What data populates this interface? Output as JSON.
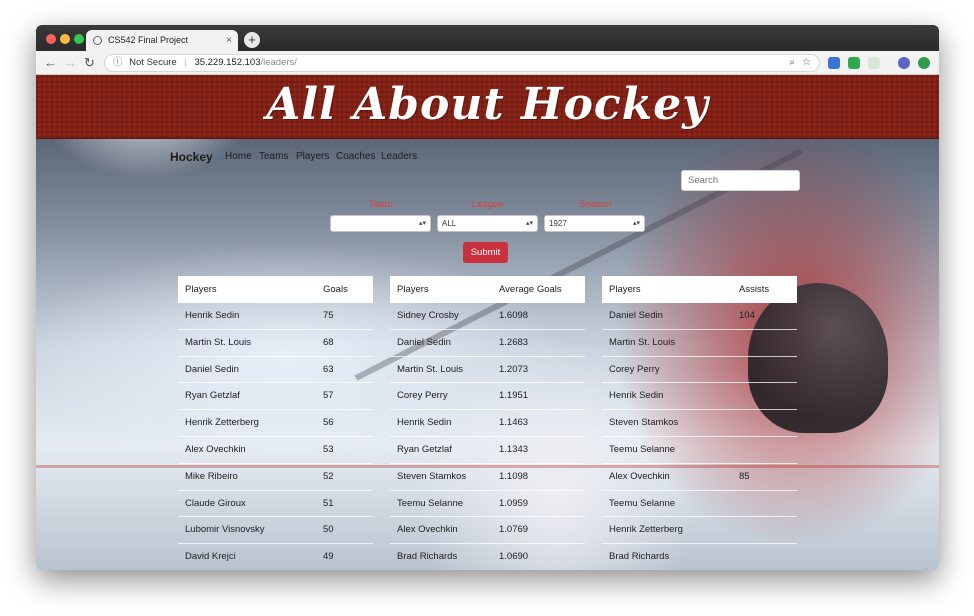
{
  "browser": {
    "tab_title": "CS542 Final Project",
    "tab_close": "×",
    "new_tab": "+",
    "security_label": "Not Secure",
    "url_host": "35.229.152.103",
    "url_path": "/leaders/",
    "nav_back": "←",
    "nav_forward": "→",
    "nav_reload": "↻",
    "zoom_icon": "⌕",
    "star_icon": "☆"
  },
  "banner": {
    "title": "All About Hockey"
  },
  "navbar": {
    "brand": "Hockey",
    "links": [
      "Home",
      "Teams",
      "Players",
      "Coaches",
      "Leaders"
    ],
    "search_placeholder": "Search"
  },
  "filters": {
    "team_label": "Team",
    "team_value": "",
    "league_label": "League",
    "league_value": "ALL",
    "season_label": "Season",
    "season_value": "1927",
    "submit_label": "Submit",
    "select_arrows": "▴▾"
  },
  "tables": [
    {
      "headers": [
        "Players",
        "Goals"
      ],
      "rows": [
        [
          "Henrik Sedin",
          "75"
        ],
        [
          "Martin St. Louis",
          "68"
        ],
        [
          "Daniel Sedin",
          "63"
        ],
        [
          "Ryan Getzlaf",
          "57"
        ],
        [
          "Henrik Zetterberg",
          "56"
        ],
        [
          "Alex Ovechkin",
          "53"
        ],
        [
          "Mike Ribeiro",
          "52"
        ],
        [
          "Claude Giroux",
          "51"
        ],
        [
          "Lubomir Visnovsky",
          "50"
        ],
        [
          "David Krejci",
          "49"
        ]
      ]
    },
    {
      "headers": [
        "Players",
        "Average Goals"
      ],
      "rows": [
        [
          "Sidney Crosby",
          "1.6098"
        ],
        [
          "Daniel Sedin",
          "1.2683"
        ],
        [
          "Martin St. Louis",
          "1.2073"
        ],
        [
          "Corey Perry",
          "1.1951"
        ],
        [
          "Henrik Sedin",
          "1.1463"
        ],
        [
          "Ryan Getzlaf",
          "1.1343"
        ],
        [
          "Steven Stamkos",
          "1.1098"
        ],
        [
          "Teemu Selanne",
          "1.0959"
        ],
        [
          "Alex Ovechkin",
          "1.0769"
        ],
        [
          "Brad Richards",
          "1.0690"
        ]
      ]
    },
    {
      "headers": [
        "Players",
        "Assists"
      ],
      "rows": [
        [
          "Daniel Sedin",
          "104"
        ],
        [
          "Martin St. Louis",
          ""
        ],
        [
          "Corey Perry",
          ""
        ],
        [
          "Henrik Sedin",
          ""
        ],
        [
          "Steven Stamkos",
          ""
        ],
        [
          "Teemu Selanne",
          ""
        ],
        [
          "Alex Ovechkin",
          "85"
        ],
        [
          "Teemu Selanne",
          ""
        ],
        [
          "Henrik Zetterberg",
          ""
        ],
        [
          "Brad Richards",
          ""
        ]
      ]
    }
  ],
  "colors": {
    "banner": "#8e2418",
    "accent_red": "#d9403a",
    "submit": "#c9303e"
  }
}
